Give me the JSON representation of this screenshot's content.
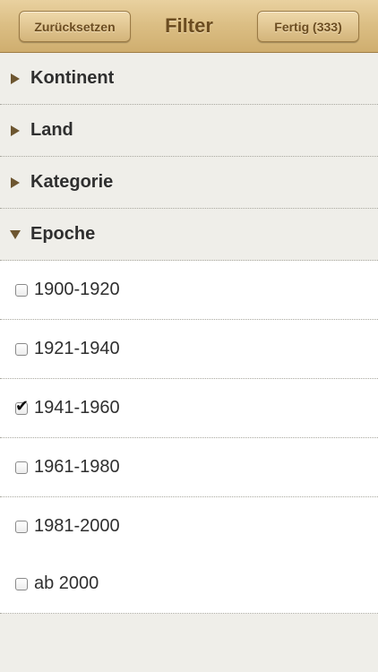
{
  "header": {
    "title": "Filter",
    "reset_label": "Zurücksetzen",
    "done_label": "Fertig (333)"
  },
  "sections": [
    {
      "label": "Kontinent",
      "expanded": false
    },
    {
      "label": "Land",
      "expanded": false
    },
    {
      "label": "Kategorie",
      "expanded": false
    },
    {
      "label": "Epoche",
      "expanded": true
    }
  ],
  "options": [
    {
      "label": "1900-1920",
      "checked": false
    },
    {
      "label": "1921-1940",
      "checked": false
    },
    {
      "label": "1941-1960",
      "checked": true
    },
    {
      "label": "1961-1980",
      "checked": false
    },
    {
      "label": "1981-2000",
      "checked": false
    },
    {
      "label": "ab 2000",
      "checked": false
    }
  ],
  "colors": {
    "header_accent": "#dcbf85",
    "header_text": "#6b4c20",
    "section_bg": "#efeee9",
    "option_bg": "#ffffff"
  }
}
